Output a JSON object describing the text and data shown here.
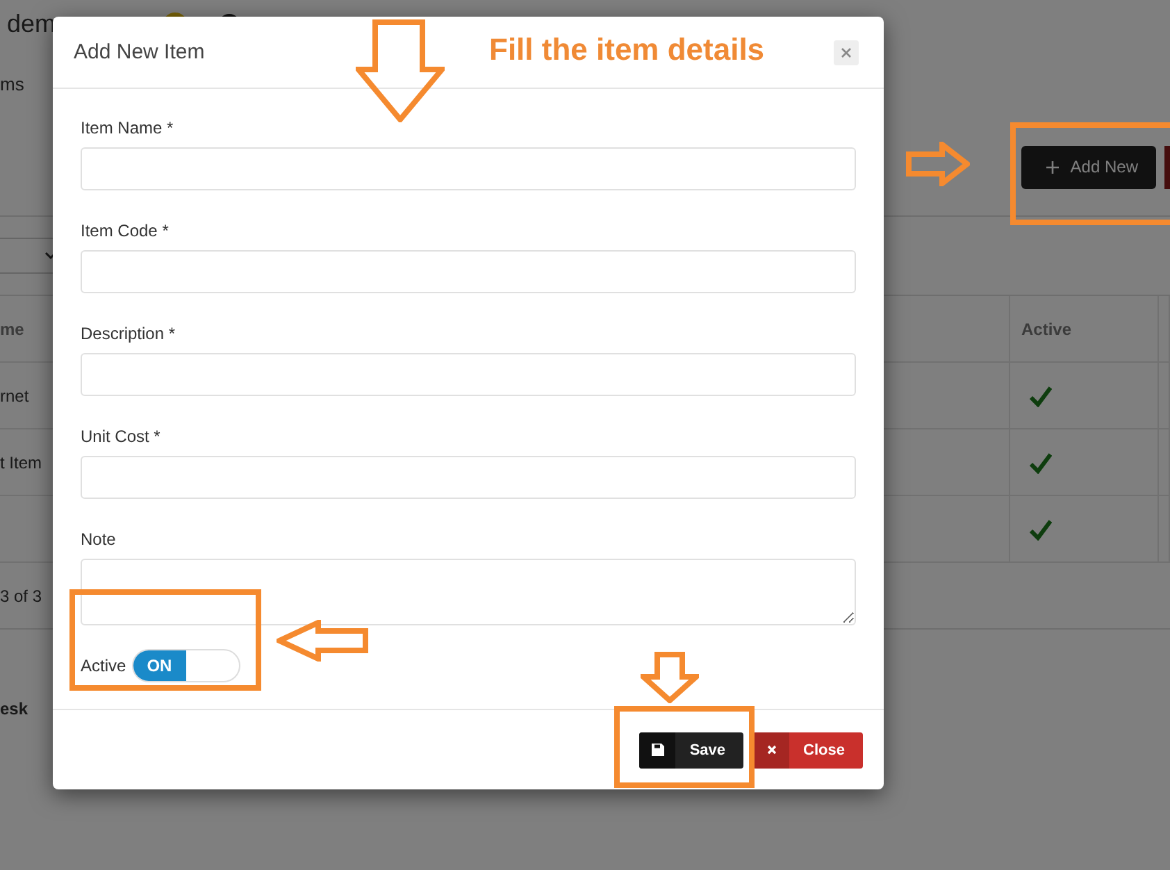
{
  "background_page": {
    "brand": "dem",
    "breadcrumb": "ms",
    "add_button": {
      "label": "Add New"
    },
    "table": {
      "columns": [
        "me",
        "Active"
      ],
      "rows": [
        {
          "name": "rnet",
          "active": true
        },
        {
          "name": "t Item",
          "active": true
        },
        {
          "active": true
        }
      ]
    },
    "pagination": "3 of 3",
    "footer_text": "esk"
  },
  "dialog": {
    "title": "Add New Item",
    "fields": [
      {
        "label": "Item Name *",
        "kind": "input"
      },
      {
        "label": "Item Code *",
        "kind": "input"
      },
      {
        "label": "Description *",
        "kind": "input"
      },
      {
        "label": "Unit Cost *",
        "kind": "input"
      },
      {
        "label": "Note",
        "kind": "textarea"
      }
    ],
    "active": {
      "label": "Active",
      "toggle_text": "ON",
      "on": true
    },
    "buttons": [
      {
        "label": "Save",
        "kind": "save"
      },
      {
        "label": "Close",
        "kind": "close"
      }
    ]
  },
  "annotation": {
    "text": "Fill the item details"
  }
}
